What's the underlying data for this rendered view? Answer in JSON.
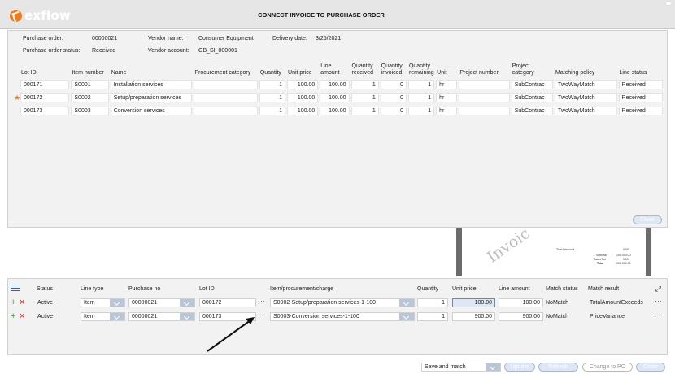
{
  "app": {
    "logo_text": "exflow",
    "title": "CONNECT INVOICE TO PURCHASE ORDER"
  },
  "header": {
    "purchase_order_label": "Purchase order:",
    "purchase_order_value": "00000021",
    "vendor_name_label": "Vendor name:",
    "vendor_name_value": "Consumer Equipment",
    "delivery_date_label": "Delivery date:",
    "delivery_date_value": "3/25/2021",
    "po_status_label": "Purchase order status:",
    "po_status_value": "Received",
    "vendor_account_label": "Vendor account:",
    "vendor_account_value": "GB_SI_000001"
  },
  "po_lines": {
    "columns": {
      "lot_id": "Lot ID",
      "item_number": "Item number",
      "name": "Name",
      "procurement_category": "Procurement category",
      "quantity": "Quantity",
      "unit_price": "Unit price",
      "line_amount": "Line amount",
      "quantity_received": "Quantity received",
      "quantity_invoiced": "Quantity invoiced",
      "quantity_remaining": "Quantity remaining",
      "unit": "Unit",
      "project_number": "Project number",
      "project_category": "Project category",
      "matching_policy": "Matching policy",
      "line_status": "Line status"
    },
    "rows": [
      {
        "lot_id": "000171",
        "item_number": "S0001",
        "name": "Installation services",
        "procurement_category": "",
        "quantity": "1",
        "unit_price": "100.00",
        "line_amount": "100.00",
        "quantity_received": "1",
        "quantity_invoiced": "0",
        "quantity_remaining": "1",
        "unit": "hr",
        "project_number": "",
        "project_category": "SubContrac",
        "matching_policy": "TwoWayMatch",
        "line_status": "Received",
        "starred": false
      },
      {
        "lot_id": "000172",
        "item_number": "S0002",
        "name": "Setup/preparation services",
        "procurement_category": "",
        "quantity": "1",
        "unit_price": "100.00",
        "line_amount": "100.00",
        "quantity_received": "1",
        "quantity_invoiced": "0",
        "quantity_remaining": "1",
        "unit": "hr",
        "project_number": "",
        "project_category": "SubContrac",
        "matching_policy": "TwoWayMatch",
        "line_status": "Received",
        "starred": true
      },
      {
        "lot_id": "000173",
        "item_number": "S0003",
        "name": "Conversion services",
        "procurement_category": "",
        "quantity": "1",
        "unit_price": "100.00",
        "line_amount": "100.00",
        "quantity_received": "1",
        "quantity_invoiced": "0",
        "quantity_remaining": "1",
        "unit": "hr",
        "project_number": "",
        "project_category": "SubContrac",
        "matching_policy": "TwoWayMatch",
        "line_status": "Received",
        "starred": false
      }
    ],
    "close_label": "Close"
  },
  "preview": {
    "watermark": "Invoic",
    "total_discount_label": "Total Discount",
    "subtotal_label": "Subtotal",
    "sales_tax_label": "Sales Tax",
    "total_label": "Total",
    "total_discount_value": "0.00",
    "subtotal_value": "100 000.00",
    "sales_tax_value": "0.00",
    "total_value": "100 000.00"
  },
  "match_lines": {
    "columns": {
      "status": "Status",
      "line_type": "Line type",
      "purchase_no": "Purchase no",
      "lot_id": "Lot ID",
      "item_charge": "Item/procurement/charge",
      "quantity": "Quantity",
      "unit_price": "Unit price",
      "line_amount": "Line amount",
      "match_status": "Match status",
      "match_result": "Match result"
    },
    "rows": [
      {
        "status": "Active",
        "line_type": "Item",
        "purchase_no": "00000021",
        "lot_id": "000172",
        "item_charge": "S0002-Setup/preparation services-1-100",
        "quantity": "1",
        "unit_price": "100.00",
        "line_amount": "100.00",
        "match_status": "NoMatch",
        "match_result": "TotalAmountExceeds"
      },
      {
        "status": "Active",
        "line_type": "Item",
        "purchase_no": "00000021",
        "lot_id": "000173",
        "item_charge": "S0003-Conversion services-1-100",
        "quantity": "1",
        "unit_price": "900.00",
        "line_amount": "900.00",
        "match_status": "NoMatch",
        "match_result": "PriceVariance"
      }
    ]
  },
  "footer": {
    "action_select": "Save and match",
    "update": "Update",
    "refresh": "Refresh",
    "change_to_po": "Change to PO",
    "close": "Close"
  }
}
